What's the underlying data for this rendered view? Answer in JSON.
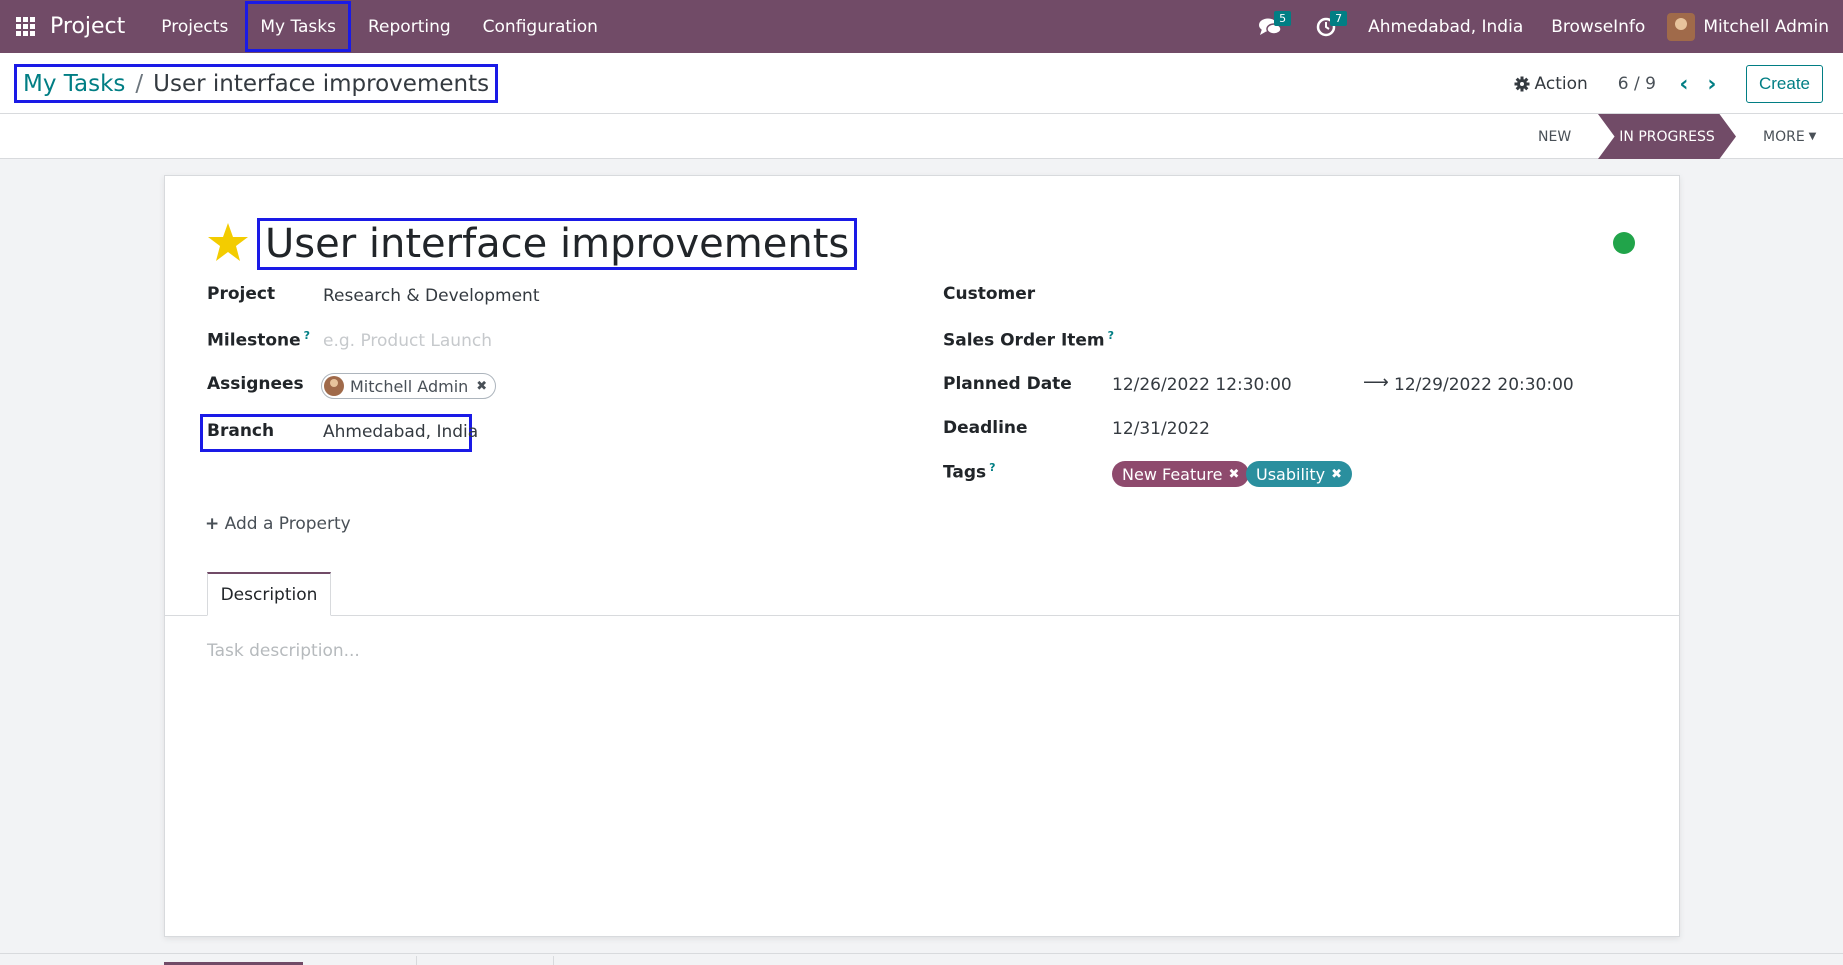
{
  "navbar": {
    "app_name": "Project",
    "menu": [
      "Projects",
      "My Tasks",
      "Reporting",
      "Configuration"
    ],
    "messages_badge": "5",
    "activities_badge": "7",
    "company": "Ahmedabad, India",
    "database": "BrowseInfo",
    "user": "Mitchell Admin"
  },
  "control_panel": {
    "breadcrumb_parent": "My Tasks",
    "breadcrumb_sep": "/",
    "breadcrumb_current": "User interface improvements",
    "action_label": "Action",
    "pager": "6 / 9",
    "create_label": "Create"
  },
  "statusbar": {
    "stage_new": "NEW",
    "stage_current": "IN PROGRESS",
    "more_label": "MORE"
  },
  "form": {
    "title": "User interface improvements",
    "left": {
      "project_label": "Project",
      "project_value": "Research & Development",
      "milestone_label": "Milestone",
      "milestone_placeholder": "e.g. Product Launch",
      "assignees_label": "Assignees",
      "assignee": "Mitchell Admin",
      "branch_label": "Branch",
      "branch_value": "Ahmedabad, India"
    },
    "right": {
      "customer_label": "Customer",
      "sale_line_label": "Sales Order Item",
      "planned_label": "Planned Date",
      "planned_start": "12/26/2022 12:30:00",
      "planned_end": "12/29/2022 20:30:00",
      "deadline_label": "Deadline",
      "deadline_value": "12/31/2022",
      "tags_label": "Tags",
      "tags": [
        "New Feature",
        "Usability"
      ]
    },
    "help_mark": "?",
    "add_property": "Add a Property",
    "tab_description": "Description",
    "description_placeholder": "Task description..."
  },
  "colors": {
    "brand": "#714b67",
    "accent": "#017e84",
    "tag_new_feature": "#8e4a6d",
    "tag_usability": "#2a8f9e",
    "kanban_state": "#21a44a",
    "highlight_box": "#1a1ae6"
  }
}
